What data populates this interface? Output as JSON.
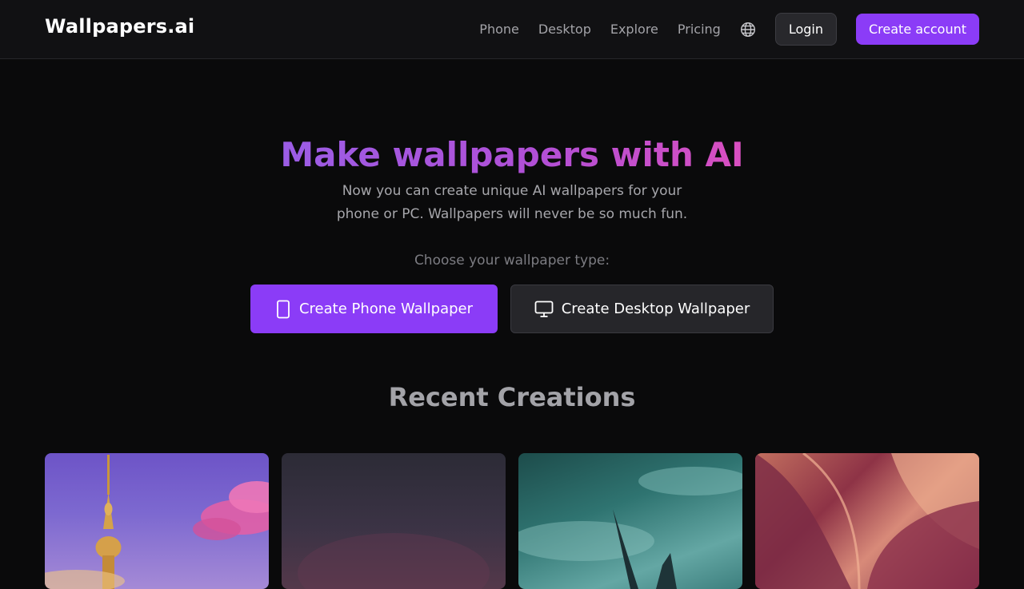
{
  "header": {
    "brand": "Wallpapers.ai",
    "nav": [
      {
        "label": "Phone"
      },
      {
        "label": "Desktop"
      },
      {
        "label": "Explore"
      },
      {
        "label": "Pricing"
      }
    ],
    "language_icon": "globe-icon",
    "login_label": "Login",
    "create_account_label": "Create account"
  },
  "hero": {
    "title": "Make wallpapers with AI",
    "subtitle_line1": "Now you can create unique AI wallpapers for your",
    "subtitle_line2": "phone or PC. Wallpapers will never be so much fun.",
    "choose_label": "Choose your wallpaper type:",
    "phone_button": "Create Phone Wallpaper",
    "phone_icon": "smartphone-icon",
    "desktop_button": "Create Desktop Wallpaper",
    "desktop_icon": "monitor-icon"
  },
  "recent": {
    "title": "Recent Creations",
    "items": [
      {
        "subject": "golden spire against pink clouds"
      },
      {
        "subject": "dark purple haze"
      },
      {
        "subject": "teal stormy sky with blade"
      },
      {
        "subject": "crimson flowing fabric"
      }
    ]
  },
  "colors": {
    "accent": "#8b3cf7",
    "background": "#0a0a0b",
    "header_bg": "#111113"
  }
}
